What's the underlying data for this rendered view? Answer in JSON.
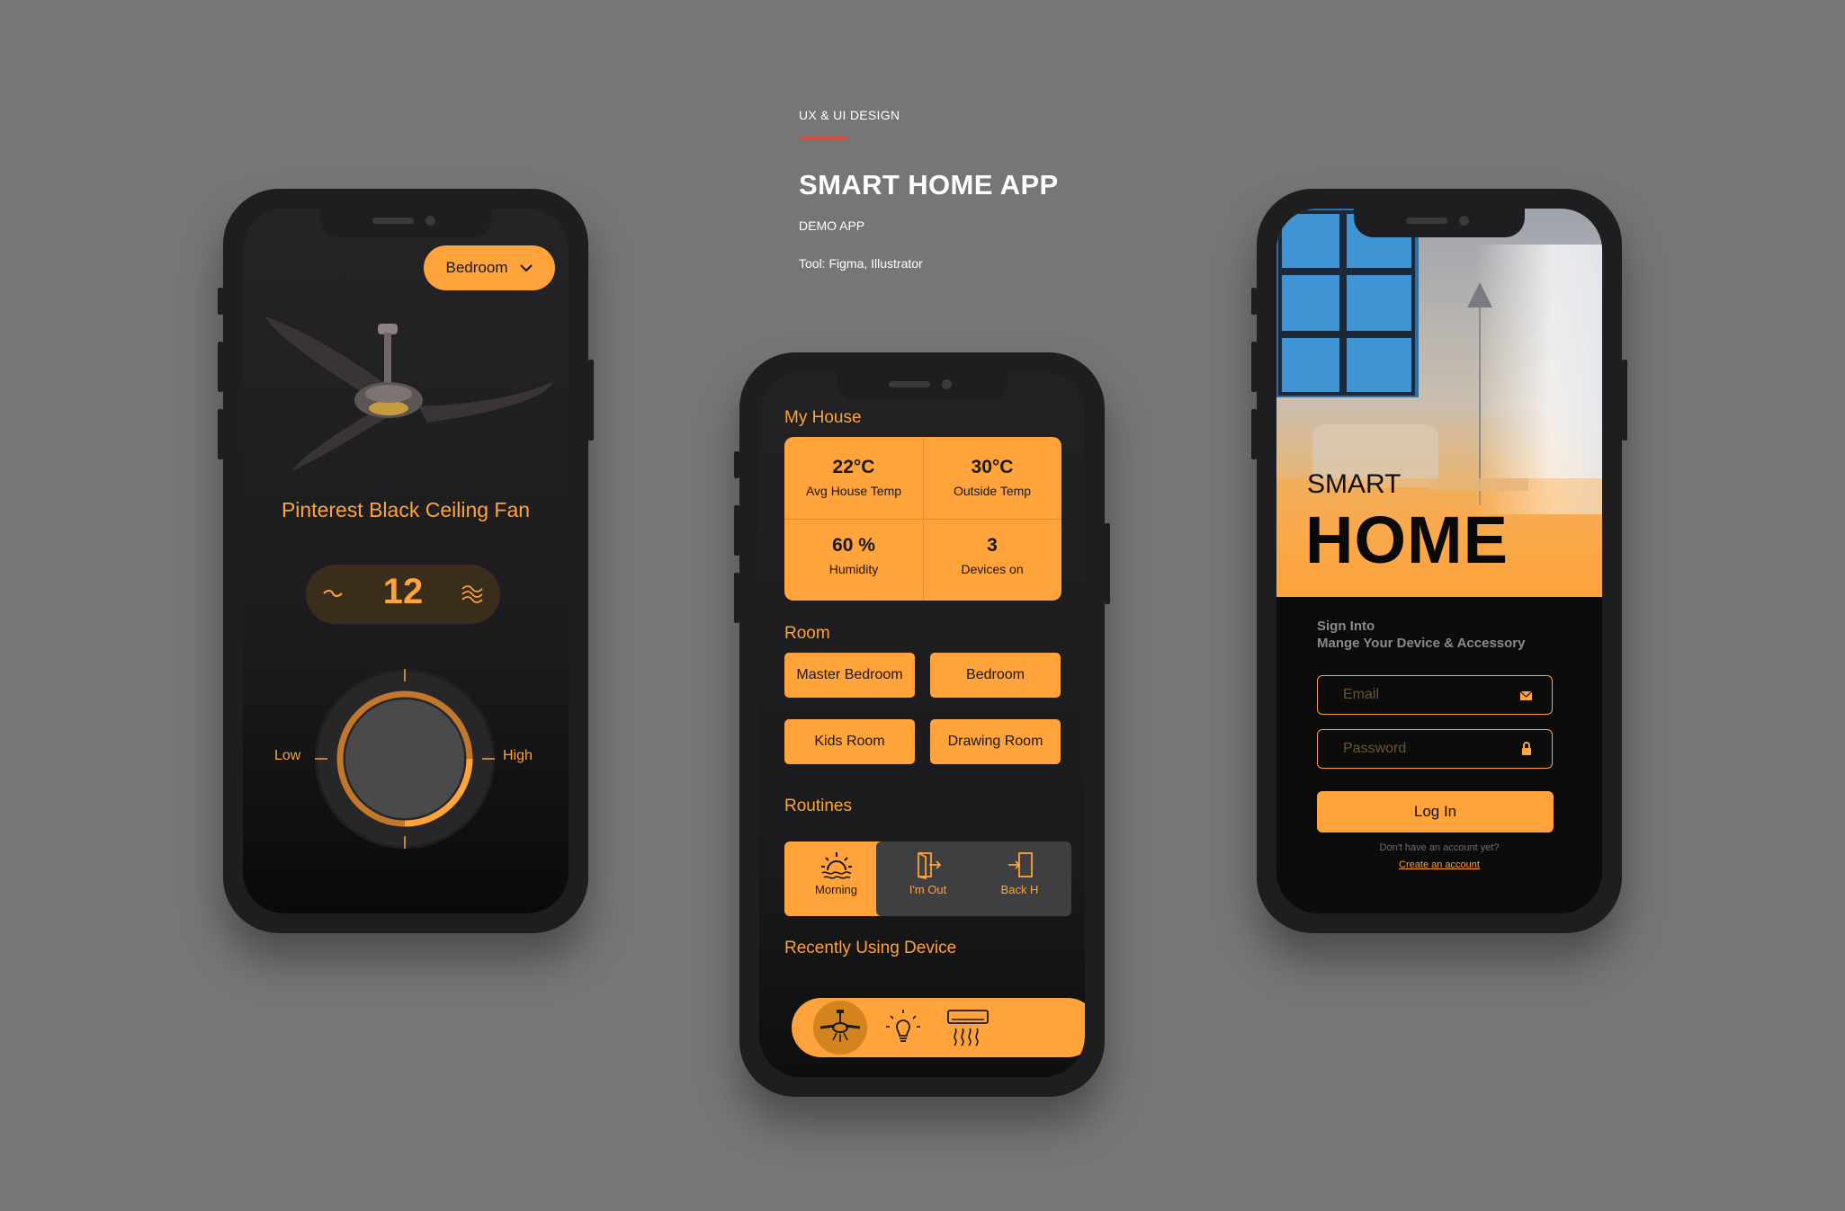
{
  "header": {
    "eyebrow": "UX & UI DESIGN",
    "title": "SMART HOME APP",
    "subtitle": "DEMO APP",
    "tools": "Tool:  Figma, Illustrator",
    "accent": "#e0483a"
  },
  "colors": {
    "primary": "#ffa33a",
    "background": "#767676",
    "phone": "#1e1e20"
  },
  "fan_screen": {
    "room_selector": "Bedroom",
    "device_name": "Pinterest Black Ceiling Fan",
    "speed": "12",
    "low_label": "Low",
    "high_label": "High",
    "icons": {
      "low_wind": "wind-low-icon",
      "high_wind": "wind-high-icon",
      "dropdown": "chevron-down-icon"
    }
  },
  "dashboard": {
    "my_house_title": "My House",
    "stats": [
      {
        "value": "22°C",
        "label": "Avg House Temp"
      },
      {
        "value": "30°C",
        "label": "Outside Temp"
      },
      {
        "value": "60 %",
        "label": "Humidity"
      },
      {
        "value": "3",
        "label": "Devices on"
      }
    ],
    "room_title": "Room",
    "rooms": [
      "Master Bedroom",
      "Bedroom",
      "Kids Room",
      "Drawing Room"
    ],
    "routines_title": "Routines",
    "routines": [
      {
        "label": "Morning",
        "icon": "sunrise-icon",
        "active": true
      },
      {
        "label": "I'm Out",
        "icon": "exit-door-icon",
        "active": false
      },
      {
        "label": "Back H",
        "icon": "enter-door-icon",
        "active": false
      }
    ],
    "recent_title": "Recently Using Device",
    "recent_devices": [
      "ceiling-fan-icon",
      "light-bulb-icon",
      "air-conditioner-icon"
    ]
  },
  "login_screen": {
    "hero_small": "SMART",
    "hero_big": "HOME",
    "signin_line1": "Sign Into",
    "signin_line2": "Mange Your Device & Accessory",
    "email_placeholder": "Email",
    "password_placeholder": "Password",
    "login_button": "Log In",
    "no_account": "Don't have an account yet?",
    "create_account": "Create an account"
  }
}
